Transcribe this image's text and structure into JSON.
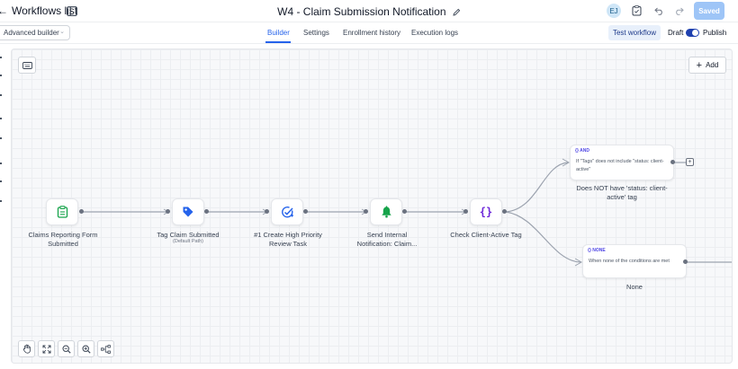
{
  "header": {
    "back_label": "Workflows list",
    "title": "W4 - Claim Submission Notification",
    "avatar_initials": "EJ",
    "saved_label": "Saved"
  },
  "subbar": {
    "builder_mode": "Advanced builder",
    "tabs": [
      {
        "label": "Builder",
        "active": true
      },
      {
        "label": "Settings",
        "active": false
      },
      {
        "label": "Enrollment history",
        "active": false
      },
      {
        "label": "Execution logs",
        "active": false
      }
    ],
    "test_workflow_label": "Test workflow",
    "draft_label": "Draft",
    "publish_label": "Publish",
    "publish_toggle_on": true
  },
  "canvas": {
    "add_label": "Add",
    "nodes": [
      {
        "label": "Claims Reporting Form Submitted",
        "icon": "clipboard-icon",
        "icon_color": "#16a34a"
      },
      {
        "label": "Tag Claim Submitted",
        "sublabel": "(Default Path)",
        "icon": "tag-icon",
        "icon_color": "#2563eb"
      },
      {
        "label": "#1 Create High Priority Review Task",
        "icon": "task-check-icon",
        "icon_color": "#2563eb"
      },
      {
        "label": "Send Internal Notification: Claim...",
        "icon": "bell-icon",
        "icon_color": "#16a34a"
      },
      {
        "label": "Check Client-Active Tag",
        "icon": "braces-icon",
        "icon_color": "#6d28d9"
      }
    ],
    "branches": [
      {
        "badge": "{} AND",
        "condition": "If \"Tags\" does not include \"status: client-active\"",
        "label": "Does NOT have 'status: client-active' tag"
      },
      {
        "badge": "{} NONE",
        "condition": "When none of the conditions are met",
        "label": "None"
      }
    ]
  },
  "colors": {
    "accent": "#2563eb",
    "saved_button": "#9ec5f7",
    "toggle": "#1e40af"
  }
}
